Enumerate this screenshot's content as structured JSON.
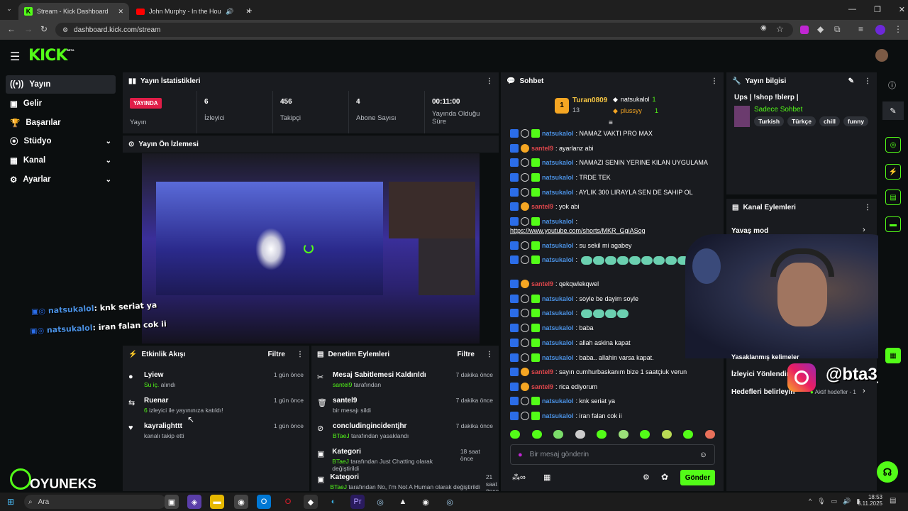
{
  "browser": {
    "tabs": [
      {
        "label": "Stream - Kick Dashboard"
      },
      {
        "label": "John Murphy - In the House"
      }
    ],
    "url": "dashboard.kick.com/stream"
  },
  "kick": {
    "logo": "KICK",
    "beta": "BETA"
  },
  "sidebar": {
    "items": [
      {
        "label": "Yayın",
        "icon": "broadcast-icon"
      },
      {
        "label": "Gelir"
      },
      {
        "label": "Başarılar"
      },
      {
        "label": "Stüdyo"
      },
      {
        "label": "Kanal"
      },
      {
        "label": "Ayarlar"
      }
    ]
  },
  "stats": {
    "title": "Yayın İstatistikleri",
    "live_badge": "YAYINDA",
    "live_label": "Yayın",
    "items": [
      {
        "value": "6",
        "label": "İzleyici"
      },
      {
        "value": "456",
        "label": "Takipçi"
      },
      {
        "value": "4",
        "label": "Abone Sayısı"
      },
      {
        "value": "00:11:00",
        "label": "Yayında Olduğu Süre"
      }
    ]
  },
  "preview": {
    "title": "Yayın Ön İzlemesi"
  },
  "activity": {
    "title": "Etkinlik Akışı",
    "filter": "Filtre",
    "items": [
      {
        "name": "Lyiew",
        "detail_g": "Su iç.",
        "detail": " alındı",
        "time": "1 gün önce"
      },
      {
        "name": "Ruenar",
        "detail_g": "6",
        "detail": " izleyici ile yayınınıza katıldı!",
        "time": "1 gün önce"
      },
      {
        "name": "kayralighttt",
        "detail_g": "",
        "detail": "kanalı takip etti",
        "time": "1 gün önce"
      }
    ]
  },
  "moderation": {
    "title": "Denetim Eylemleri",
    "filter": "Filtre",
    "items": [
      {
        "name": "Mesaj Sabitlemesi Kaldırıldı",
        "detail_g": "santel9",
        "detail": " tarafından",
        "time": "7 dakika önce"
      },
      {
        "name": "santel9",
        "detail_g": "",
        "detail": "bir mesajı sildi",
        "time": "7 dakika önce"
      },
      {
        "name": "concludingincidentjhr",
        "detail_g": "BTaeJ",
        "detail": " tarafından yasaklandı",
        "time": "7 dakika önce"
      },
      {
        "name": "Kategori",
        "detail_g": "BTaeJ",
        "detail": " tarafından Just Chatting olarak değiştirildi",
        "time": "18 saat önce"
      },
      {
        "name": "Kategori",
        "detail_g": "BTaeJ",
        "detail": " tarafından No, I'm Not A Human olarak değiştirildi",
        "time": "21 saat önce"
      }
    ]
  },
  "chat": {
    "title": "Sohbet",
    "leaderboard": {
      "first": "Turan0809",
      "first_count": "13",
      "second": "natsukalol",
      "second_count": "1",
      "third": "plussyy",
      "third_count": "1"
    },
    "messages": [
      {
        "user": "natsukalol",
        "color": "blue",
        "text": ": NAMAZ VAKTI PRO MAX"
      },
      {
        "user": "santel9",
        "color": "red",
        "text": ": ayarlanz abi"
      },
      {
        "user": "natsukalol",
        "color": "blue",
        "text": ": NAMAZI SENIN YERINE KILAN UYGULAMA"
      },
      {
        "user": "natsukalol",
        "color": "blue",
        "text": ": TRDE TEK"
      },
      {
        "user": "natsukalol",
        "color": "blue",
        "text": ": AYLIK 300 LIRAYLA SEN DE SAHIP OL"
      },
      {
        "user": "santel9",
        "color": "red",
        "text": ": yok abi"
      },
      {
        "user": "natsukalol",
        "color": "blue",
        "text": ":"
      },
      {
        "user": "",
        "color": "link",
        "text": "https://www.youtube.com/shorts/MKR_GgiASog"
      },
      {
        "user": "natsukalol",
        "color": "blue",
        "text": ": su sekil mi agabey"
      },
      {
        "user": "natsukalol",
        "color": "blue",
        "text": ":"
      },
      {
        "user": "santel9",
        "color": "red",
        "text": ": qekqwlekqwel"
      },
      {
        "user": "natsukalol",
        "color": "blue",
        "text": ": soyle be dayim soyle"
      },
      {
        "user": "natsukalol",
        "color": "blue",
        "text": ":"
      },
      {
        "user": "natsukalol",
        "color": "blue",
        "text": ": baba"
      },
      {
        "user": "natsukalol",
        "color": "blue",
        "text": ": allah askina kapat"
      },
      {
        "user": "natsukalol",
        "color": "blue",
        "text": ": baba.. allahin varsa kapat."
      },
      {
        "user": "santel9",
        "color": "red",
        "text": ": sayın cumhurbaskanım bize 1 saatçiuk verun"
      },
      {
        "user": "santel9",
        "color": "red",
        "text": ": rica ediyorum"
      },
      {
        "user": "natsukalol",
        "color": "blue",
        "text": ": knk seriat ya"
      },
      {
        "user": "natsukalol",
        "color": "blue",
        "text": ": iran falan cok ii"
      }
    ],
    "input_placeholder": "Bir mesaj gönderin",
    "send": "Gönder"
  },
  "streaminfo": {
    "title": "Yayın bilgisi",
    "stream_title": "Ups | !shop !blerp |",
    "category": "Sadece Sohbet",
    "tags": [
      "Turkish",
      "Türkçe",
      "chill",
      "funny"
    ]
  },
  "channel_actions": {
    "title": "Kanal Eylemleri",
    "slow_mode": "Yavaş mod",
    "banned_words": "Yasaklanmış kelimeler",
    "viewer_redirect": "İzleyici Yönlendir",
    "goals": "Hedefleri belirleyin",
    "active_goals": "Aktif hedefler - 1"
  },
  "overlay": {
    "chat1_user": "natsukalol",
    "chat1_text": ": knk seriat ya",
    "chat2_user": "natsukalol",
    "chat2_text": ": iran falan cok ii",
    "instagram": "@bta3j",
    "watermark": "OYUNEKS"
  },
  "taskbar": {
    "search": "Ara",
    "time": "18:53",
    "date": "6.11.2025"
  }
}
